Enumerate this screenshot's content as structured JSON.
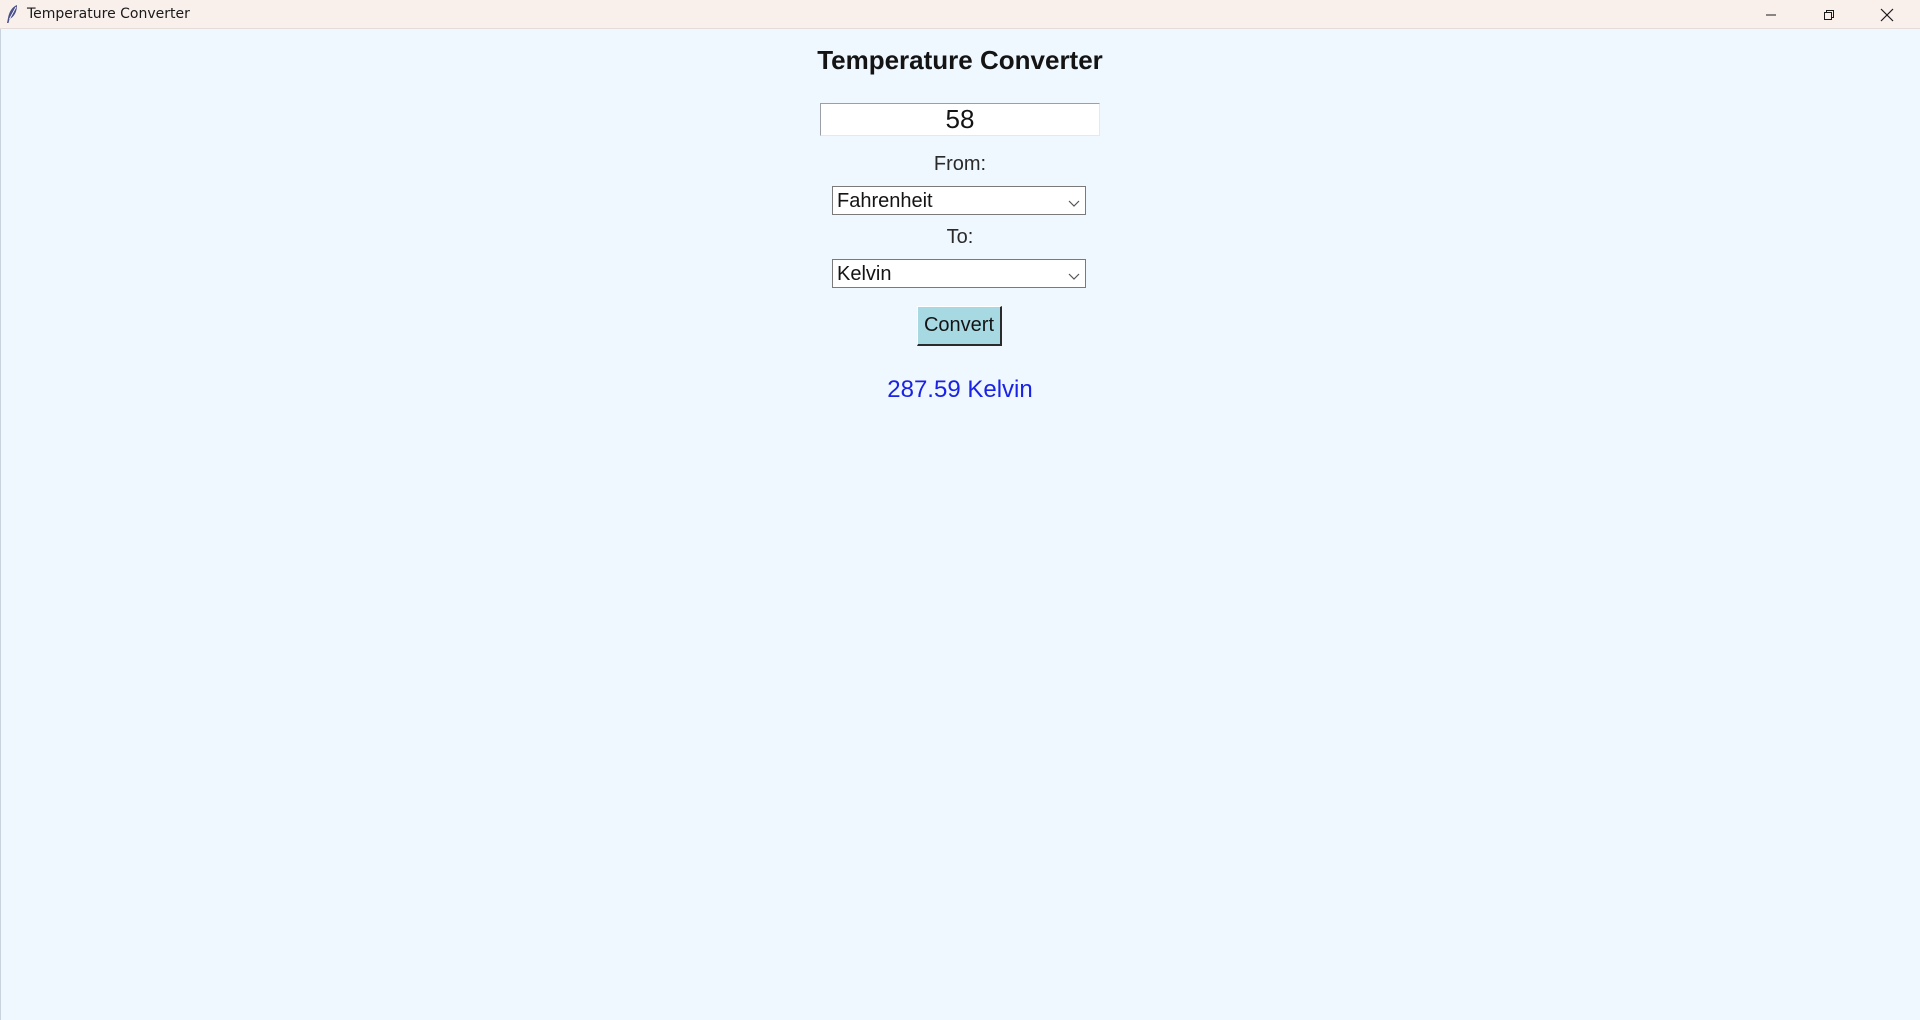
{
  "window": {
    "title": "Temperature Converter",
    "app_icon": "feather-icon",
    "controls": {
      "minimize_icon": "minimize-icon",
      "restore_icon": "restore-icon",
      "close_icon": "close-icon"
    }
  },
  "main": {
    "heading": "Temperature Converter",
    "input_value": "58",
    "from_label": "From:",
    "from_selected": "Fahrenheit",
    "to_label": "To:",
    "to_selected": "Kelvin",
    "convert_label": "Convert",
    "result": "287.59 Kelvin"
  },
  "colors": {
    "background": "#eff7ff",
    "titlebar": "#f9efeb",
    "button": "#a7d9e3",
    "result_text": "#1a22e6"
  }
}
